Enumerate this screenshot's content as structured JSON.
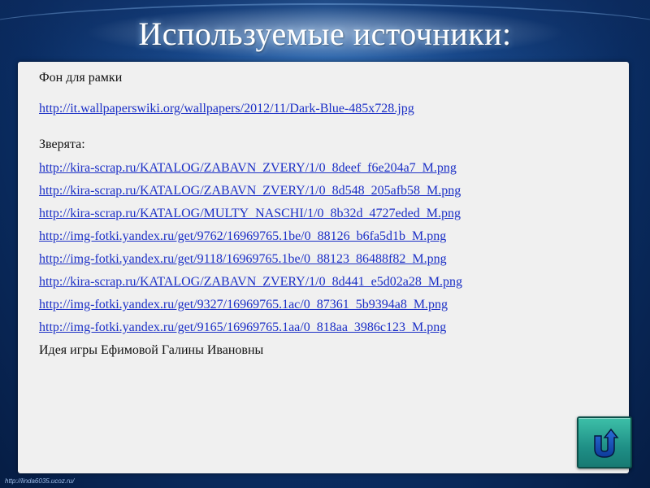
{
  "slide": {
    "title": "Используемые источники:",
    "background_color": "#0b2f63",
    "panel_color": "#f0f0f0",
    "link_color": "#1b2fc6"
  },
  "content": {
    "frame_heading": "Фон для рамки",
    "frame_link": "http://it.wallpaperswiki.org/wallpapers/2012/11/Dark-Blue-485x728.jpg",
    "animals_label": "Зверята:",
    "animal_links": [
      "http://kira-scrap.ru/KATALOG/ZABAVN_ZVERY/1/0_8deef_f6e204a7_M.png",
      "http://kira-scrap.ru/KATALOG/ZABAVN_ZVERY/1/0_8d548_205afb58_M.png",
      "http://kira-scrap.ru/KATALOG/MULTY_NASCHI/1/0_8b32d_4727eded_M.png",
      "http://img-fotki.yandex.ru/get/9762/16969765.1be/0_88126_b6fa5d1b_M.png",
      "http://img-fotki.yandex.ru/get/9118/16969765.1be/0_88123_86488f82_M.png",
      "http://kira-scrap.ru/KATALOG/ZABAVN_ZVERY/1/0_8d441_e5d02a28_M.png",
      "http://img-fotki.yandex.ru/get/9327/16969765.1ac/0_87361_5b9394a8_M.png",
      "http://img-fotki.yandex.ru/get/9165/16969765.1aa/0_818aa_3986c123_M.png"
    ],
    "credit": "Идея игры Ефимовой Галины Ивановны"
  },
  "return_button": {
    "icon": "u-turn-return-icon",
    "color": "#1f8f86"
  },
  "footer": {
    "url": "http://linda6035.ucoz.ru/"
  }
}
